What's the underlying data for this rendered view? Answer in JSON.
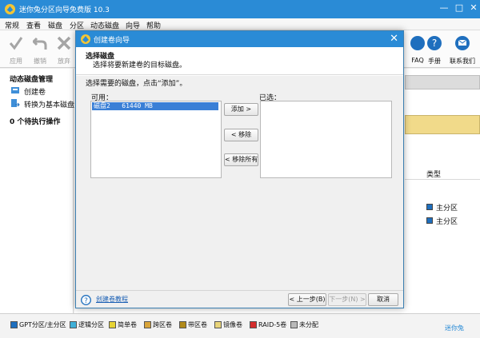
{
  "app": {
    "title": "迷你兔分区向导免费版 10.3",
    "window_controls": [
      "minimize-icon",
      "maximize-icon",
      "close-icon"
    ]
  },
  "menu": [
    "常规",
    "查看",
    "磁盘",
    "分区",
    "动态磁盘",
    "向导",
    "帮助"
  ],
  "toolbar": {
    "left": [
      {
        "label": "应用",
        "icon": "check-icon"
      },
      {
        "label": "撤销",
        "icon": "undo-icon"
      },
      {
        "label": "放弃",
        "icon": "discard-icon"
      }
    ],
    "right": [
      {
        "label": "FAQ",
        "icon": "faq-icon"
      },
      {
        "label": "手册",
        "icon": "help-icon"
      },
      {
        "label": "联系我们",
        "icon": "mail-icon"
      }
    ]
  },
  "sidebar": {
    "section_title": "动态磁盘管理",
    "items": [
      {
        "label": "创建卷",
        "icon": "create-volume-icon"
      },
      {
        "label": "转换为基本磁盘",
        "icon": "convert-disk-icon"
      }
    ],
    "pending": "0 个待执行操作"
  },
  "main": {
    "column_header_type": "类型",
    "rows": [
      {
        "type": "主分区"
      },
      {
        "type": "主分区"
      }
    ]
  },
  "legend": [
    {
      "label": "GPT分区/主分区",
      "color": "#1f6fbe"
    },
    {
      "label": "逻辑分区",
      "color": "#3fb0d8"
    },
    {
      "label": "简单卷",
      "color": "#e6d335"
    },
    {
      "label": "跨区卷",
      "color": "#d8a43a"
    },
    {
      "label": "带区卷",
      "color": "#b18a1a"
    },
    {
      "label": "镜像卷",
      "color": "#e8d47a"
    },
    {
      "label": "RAID-5卷",
      "color": "#d42d2d"
    },
    {
      "label": "未分配",
      "color": "#b9b9b9"
    }
  ],
  "brand": "迷你兔",
  "dialog": {
    "title": "创建卷向导",
    "heading": "选择磁盘",
    "subheading": "选择将要新建卷的目标磁盘。",
    "instruction": "选择需要的磁盘，点击“添加”。",
    "available_label": "可用：",
    "selected_label": "已选：",
    "available_items": [
      "磁盘2   61440 MB"
    ],
    "selected_items": [],
    "buttons": {
      "add": "添加 >",
      "remove": "< 移除",
      "remove_all": "< 移除所有",
      "back": "< 上一步(B)",
      "next": "下一步(N) >",
      "cancel": "取消"
    },
    "help_link": "创建卷教程"
  }
}
